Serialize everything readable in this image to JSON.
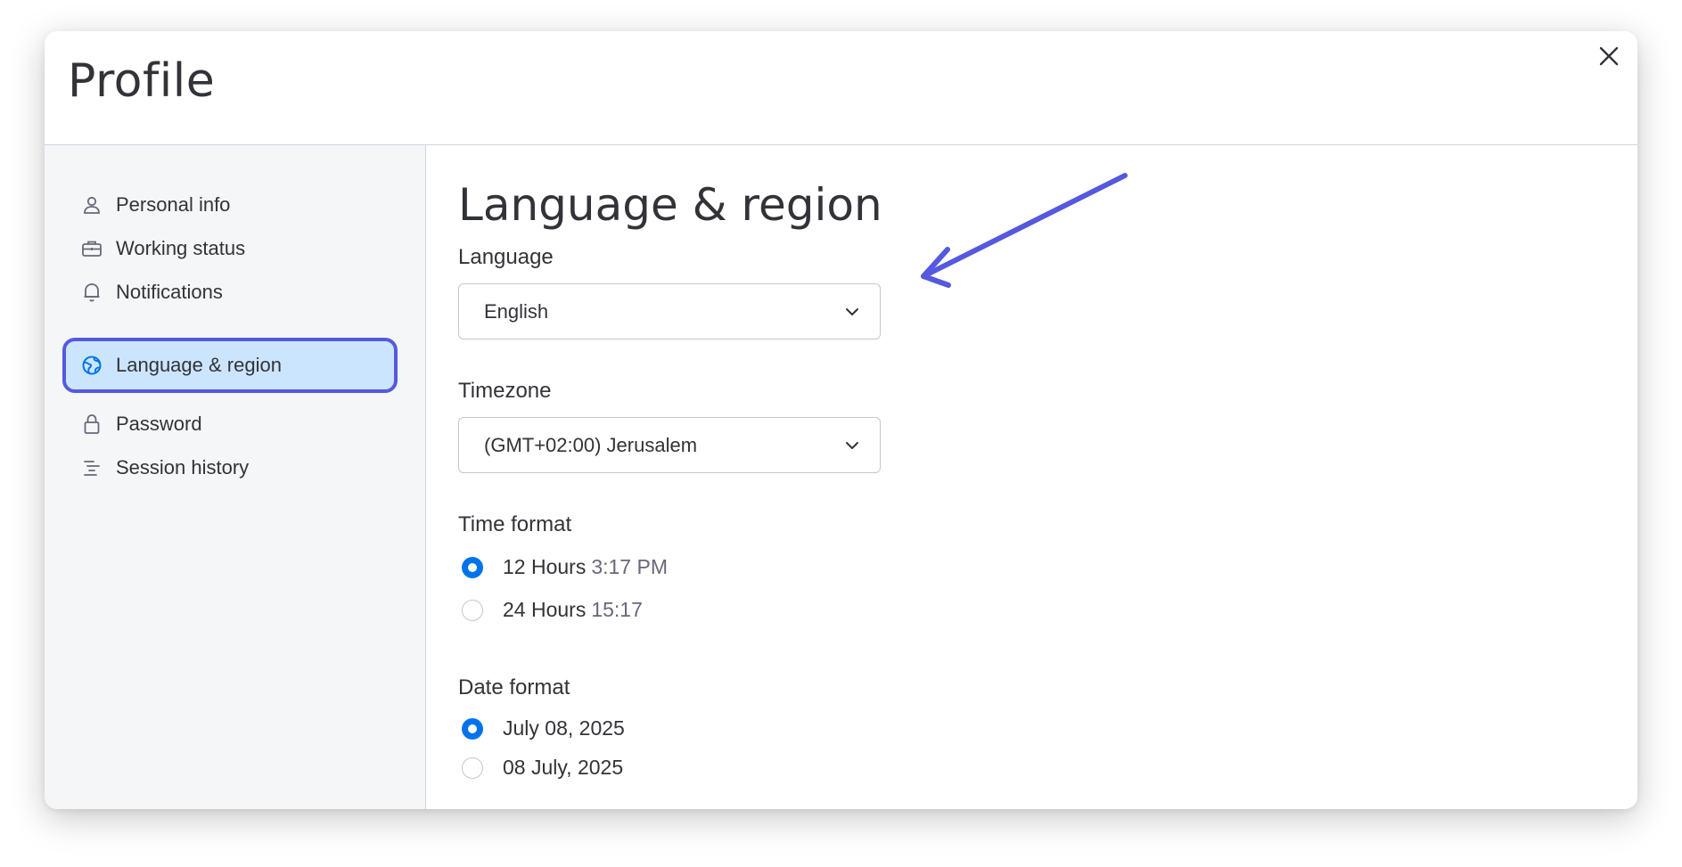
{
  "modal": {
    "title": "Profile"
  },
  "sidebar": {
    "items": [
      {
        "label": "Personal info",
        "icon": "person-icon"
      },
      {
        "label": "Working status",
        "icon": "briefcase-icon"
      },
      {
        "label": "Notifications",
        "icon": "bell-icon"
      },
      {
        "label": "Language & region",
        "icon": "globe-icon",
        "active": true
      },
      {
        "label": "Password",
        "icon": "lock-icon"
      },
      {
        "label": "Session history",
        "icon": "list-icon"
      }
    ]
  },
  "main": {
    "title": "Language & region",
    "language": {
      "label": "Language",
      "value": "English"
    },
    "timezone": {
      "label": "Timezone",
      "value": "(GMT+02:00) Jerusalem"
    },
    "time_format": {
      "label": "Time format",
      "options": [
        {
          "label": "12 Hours",
          "example": "3:17 PM",
          "selected": true
        },
        {
          "label": "24 Hours",
          "example": "15:17",
          "selected": false
        }
      ]
    },
    "date_format": {
      "label": "Date format",
      "options": [
        {
          "label": "July 08, 2025",
          "selected": true
        },
        {
          "label": "08 July, 2025",
          "selected": false
        }
      ]
    }
  },
  "colors": {
    "accent": "#0073ea",
    "highlight": "#5559df",
    "active_bg": "#cce5ff",
    "sidebar_bg": "#f5f6f8"
  }
}
